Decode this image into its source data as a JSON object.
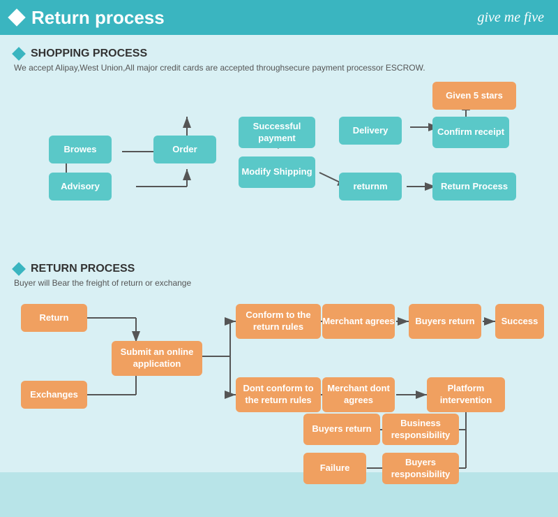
{
  "header": {
    "title": "Return process",
    "logo": "give me five"
  },
  "shopping_process": {
    "title": "SHOPPING PROCESS",
    "description": "We accept Alipay,West Union,All major credit cards are accepted throughsecure payment processor ESCROW.",
    "boxes": [
      {
        "id": "browes",
        "label": "Browes"
      },
      {
        "id": "order",
        "label": "Order"
      },
      {
        "id": "advisory",
        "label": "Advisory"
      },
      {
        "id": "modify_shipping",
        "label": "Modify Shipping"
      },
      {
        "id": "successful_payment",
        "label": "Successful payment"
      },
      {
        "id": "delivery",
        "label": "Delivery"
      },
      {
        "id": "confirm_receipt",
        "label": "Confirm receipt"
      },
      {
        "id": "given_5_stars",
        "label": "Given 5 stars"
      },
      {
        "id": "returnm",
        "label": "returnm"
      },
      {
        "id": "return_process",
        "label": "Return Process"
      }
    ]
  },
  "return_process": {
    "title": "RETURN PROCESS",
    "description": "Buyer will Bear the freight of return or exchange",
    "boxes": [
      {
        "id": "return",
        "label": "Return"
      },
      {
        "id": "exchanges",
        "label": "Exchanges"
      },
      {
        "id": "submit_online",
        "label": "Submit an online application"
      },
      {
        "id": "conform_return",
        "label": "Conform to the return rules"
      },
      {
        "id": "dont_conform",
        "label": "Dont conform to the return rules"
      },
      {
        "id": "merchant_agrees",
        "label": "Merchant agrees"
      },
      {
        "id": "merchant_dont",
        "label": "Merchant dont agrees"
      },
      {
        "id": "buyers_return1",
        "label": "Buyers return"
      },
      {
        "id": "buyers_return2",
        "label": "Buyers return"
      },
      {
        "id": "platform_intervention",
        "label": "Platform intervention"
      },
      {
        "id": "success",
        "label": "Success"
      },
      {
        "id": "business_responsibility",
        "label": "Business responsibility"
      },
      {
        "id": "buyers_responsibility",
        "label": "Buyers responsibility"
      },
      {
        "id": "failure",
        "label": "Failure"
      }
    ]
  }
}
